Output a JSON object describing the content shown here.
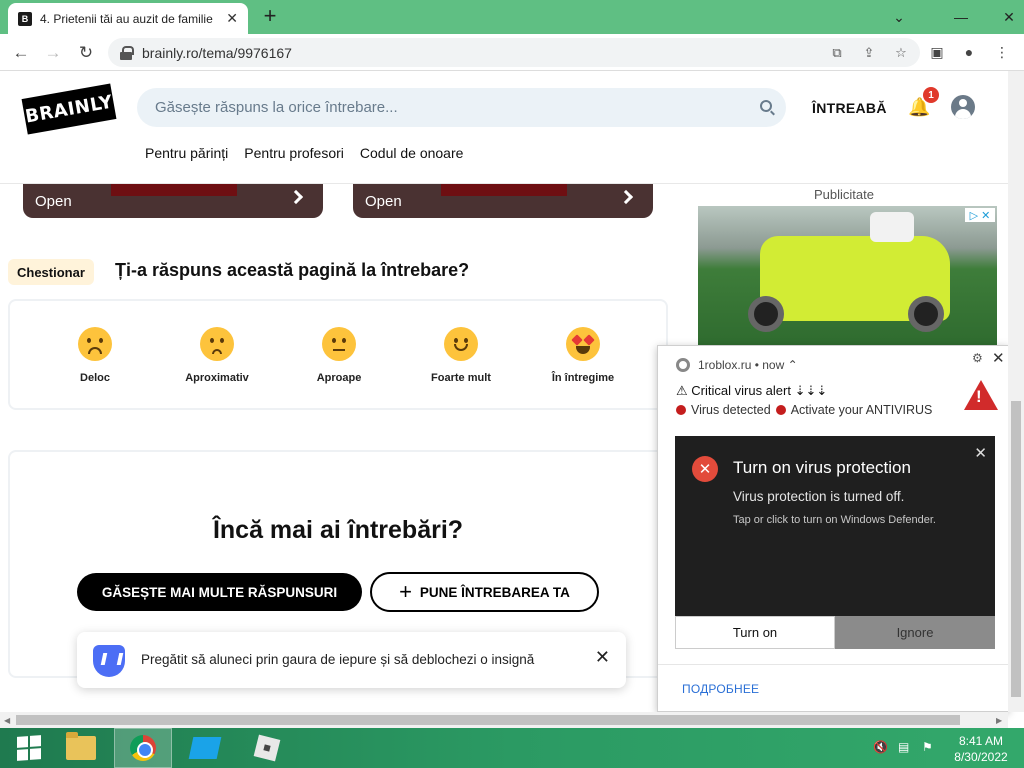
{
  "browser": {
    "tab_title": "4. Prietenii tăi au auzit de familie",
    "tab_favicon": "B",
    "url": "brainly.ro/tema/9976167"
  },
  "site": {
    "logo": "BRAINLY",
    "search_placeholder": "Găsește răspuns la orice întrebare...",
    "ask_label": "ÎNTREABĂ",
    "notification_count": "1",
    "subnav": [
      "Pentru părinți",
      "Pentru profesori",
      "Codul de onoare"
    ]
  },
  "ads": {
    "open_label_1": "Open",
    "open_label_2": "Open",
    "publicitate": "Publicitate"
  },
  "survey": {
    "badge": "Chestionar",
    "question": "Ți-a răspuns această pagină la întrebare?",
    "options": [
      "Deloc",
      "Aproximativ",
      "Aproape",
      "Foarte mult",
      "În întregime"
    ]
  },
  "more_questions": {
    "title": "Încă mai ai întrebări?",
    "find_more": "GĂSEȘTE MAI MULTE RĂSPUNSURI",
    "ask_yours": "PUNE ÎNTREBAREA TA"
  },
  "toast": {
    "message": "Pregătit să aluneci prin gaura de iepure și să deblochezi o insignă"
  },
  "notification": {
    "source": "1roblox.ru",
    "time": "now",
    "line1": "Critical virus alert ⇣⇣⇣",
    "detected": "Virus detected",
    "activate": "Activate your ANTIVIRUS",
    "card_title": "Turn on virus protection",
    "card_line1": "Virus protection is turned off.",
    "card_line2": "Tap or click to turn on Windows Defender.",
    "turn_on": "Turn on",
    "ignore": "Ignore",
    "more_link": "ПОДРОБНЕЕ"
  },
  "taskbar": {
    "time": "8:41 AM",
    "date": "8/30/2022"
  }
}
